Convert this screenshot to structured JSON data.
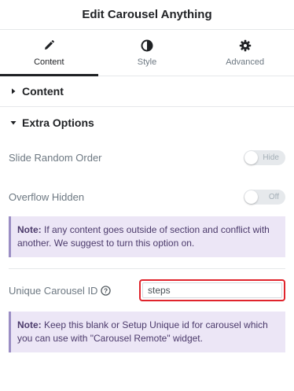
{
  "header": {
    "title": "Edit Carousel Anything"
  },
  "tabs": [
    {
      "label": "Content",
      "icon": "pencil-icon",
      "active": true
    },
    {
      "label": "Style",
      "icon": "half-circle-icon",
      "active": false
    },
    {
      "label": "Advanced",
      "icon": "gear-icon",
      "active": false
    }
  ],
  "sections": {
    "content": {
      "title": "Content",
      "expanded": false
    },
    "extra_options": {
      "title": "Extra Options",
      "expanded": true
    }
  },
  "controls": {
    "slide_random_order": {
      "label": "Slide Random Order",
      "switch_text": "Hide"
    },
    "overflow_hidden": {
      "label": "Overflow Hidden",
      "switch_text": "Off"
    },
    "unique_carousel_id": {
      "label": "Unique Carousel ID",
      "value": "steps"
    }
  },
  "notes": {
    "overflow": {
      "strong": "Note:",
      "text": " If any content goes outside of section and conflict with another. We suggest to turn this option on."
    },
    "unique_id": {
      "strong": "Note:",
      "text": " Keep this blank or Setup Unique id for carousel which you can use with \"Carousel Remote\" widget."
    }
  },
  "colors": {
    "accent": "#1f2124",
    "note_bg": "#ece6f6",
    "note_border": "#9b8ec4",
    "highlight": "#e0242c"
  }
}
